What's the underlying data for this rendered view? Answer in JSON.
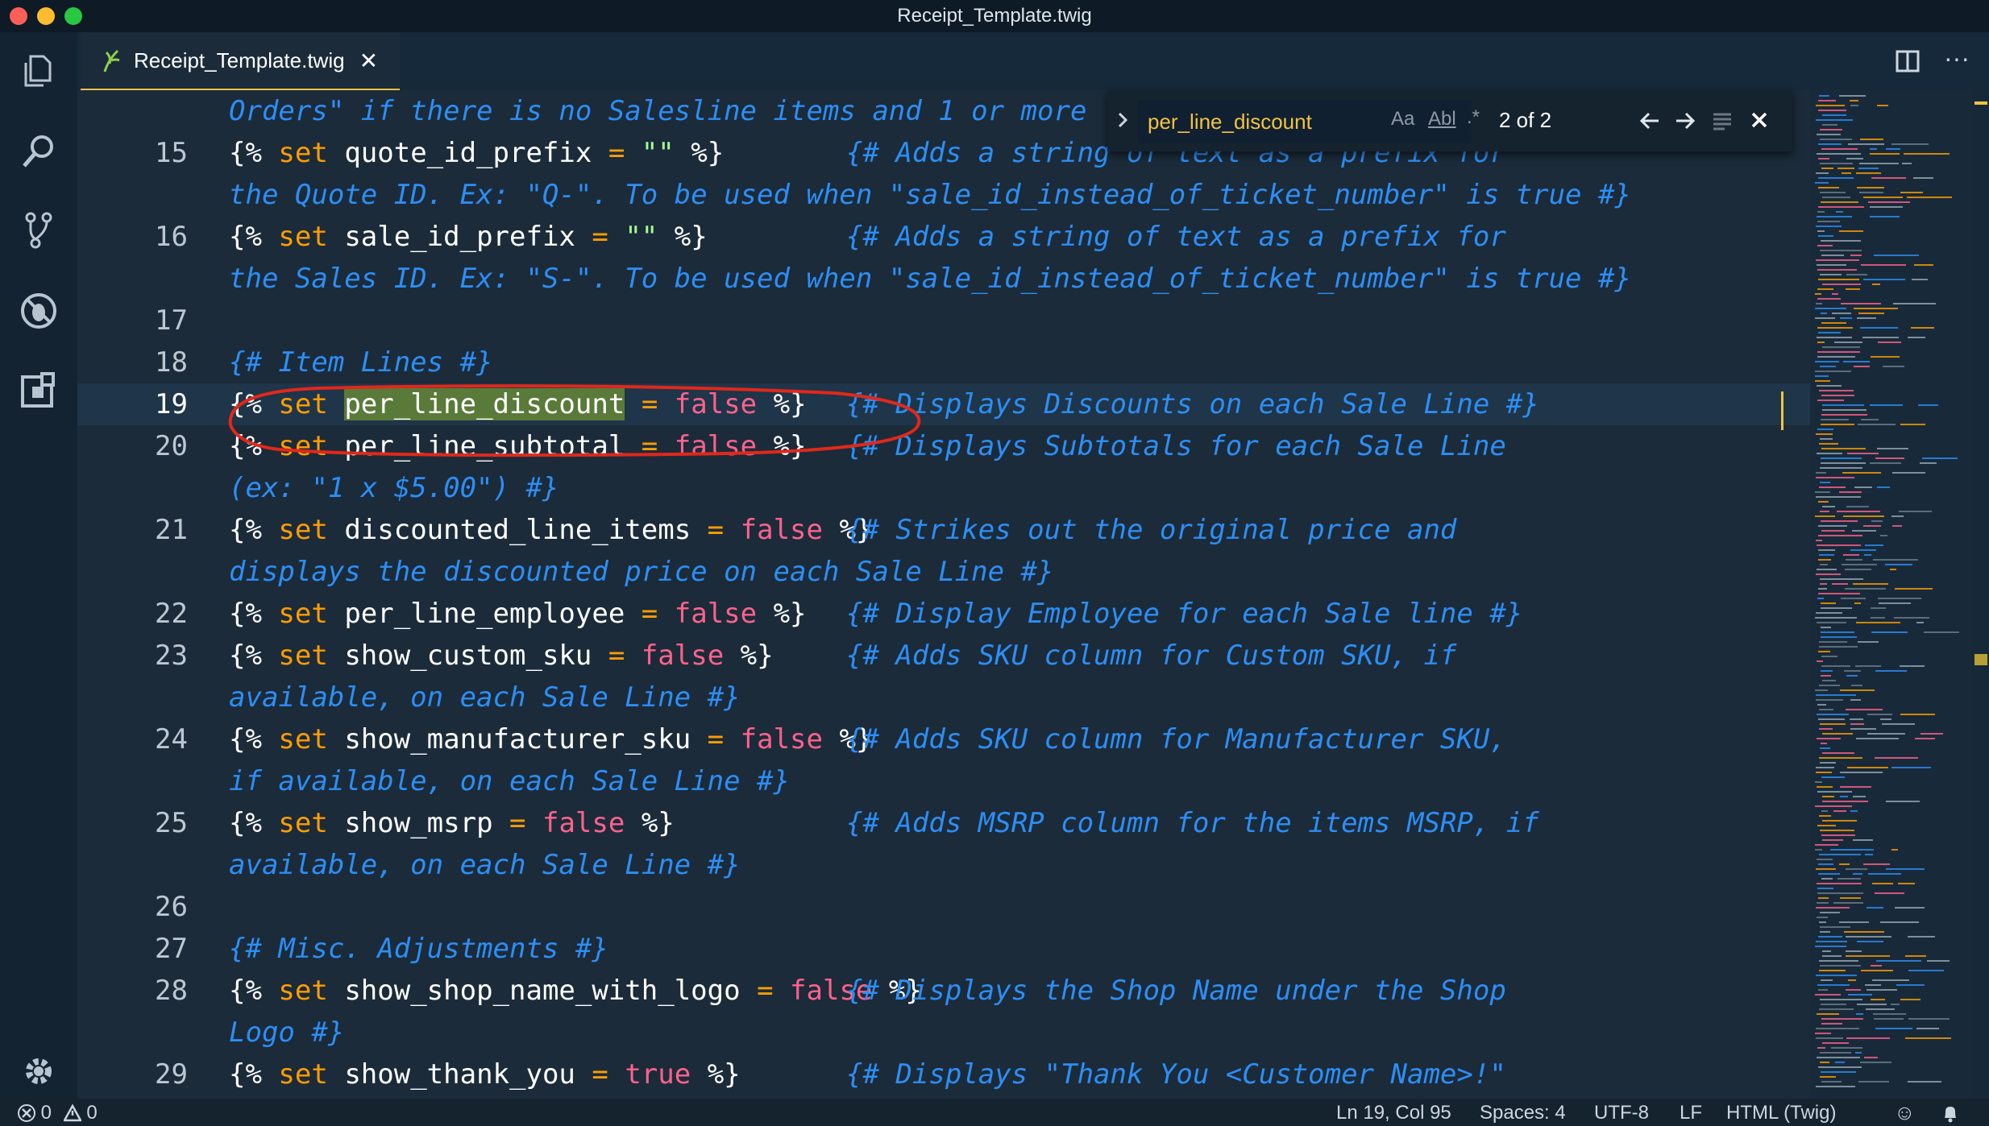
{
  "window": {
    "title": "Receipt_Template.twig"
  },
  "tab": {
    "label": "Receipt_Template.twig"
  },
  "find": {
    "value": "per_line_discount",
    "case_label": "Aa",
    "word_label": "Abl",
    "regex_label": ".*",
    "result_count": "2 of 2"
  },
  "editor": {
    "top_fragment": "Orders\" if there is no Salesline items and 1 or more",
    "lines": [
      {
        "ln": "15",
        "code_html": "{% <span class='kw'>set</span> quote_id_prefix <span class='op'>=</span> <span class='str'>\"\"</span> %}",
        "comment": "{# Adds a string of text as a prefix for",
        "wrap": "the Quote ID. Ex: \"Q-\". To be used when \"sale_id_instead_of_ticket_number\" is true #}"
      },
      {
        "ln": "16",
        "code_html": "{% <span class='kw'>set</span> sale_id_prefix <span class='op'>=</span> <span class='str'>\"\"</span> %}",
        "comment": "{# Adds a string of text as a prefix for",
        "wrap": "the Sales ID. Ex: \"S-\". To be used when \"sale_id_instead_of_ticket_number\" is true #}"
      },
      {
        "ln": "17",
        "code_html": "",
        "comment": "",
        "wrap": ""
      },
      {
        "ln": "18",
        "code_html": "<span style='color:#2d8ef5;font-style:italic'>{# Item Lines #}</span>",
        "comment": "",
        "wrap": ""
      },
      {
        "ln": "19",
        "code_html": "{% <span class='kw'>set</span> <span class='hl'>per_line_discount</span> <span class='op'>=</span> <span class='bool'>false</span> %}",
        "comment": "{# Displays Discounts on each Sale Line #}",
        "wrap": "",
        "current": true
      },
      {
        "ln": "20",
        "code_html": "{% <span class='kw'>set</span> per_line_subtotal <span class='op'>=</span> <span class='bool'>false</span> %}",
        "comment": "{# Displays Subtotals for each Sale Line",
        "wrap": "(ex: \"1 x $5.00\") #}"
      },
      {
        "ln": "21",
        "code_html": "{% <span class='kw'>set</span> discounted_line_items <span class='op'>=</span> <span class='bool'>false</span> %}",
        "comment": "{# Strikes out the original price and",
        "wrap": "displays the discounted price on each Sale Line #}"
      },
      {
        "ln": "22",
        "code_html": "{% <span class='kw'>set</span> per_line_employee <span class='op'>=</span> <span class='bool'>false</span> %}",
        "comment": "{# Display Employee for each Sale line #}",
        "wrap": ""
      },
      {
        "ln": "23",
        "code_html": "{% <span class='kw'>set</span> show_custom_sku <span class='op'>=</span> <span class='bool'>false</span> %}",
        "comment": "{# Adds SKU column for Custom SKU, if",
        "wrap": "available, on each Sale Line #}"
      },
      {
        "ln": "24",
        "code_html": "{% <span class='kw'>set</span> show_manufacturer_sku <span class='op'>=</span> <span class='bool'>false</span> %}",
        "comment": "{# Adds SKU column for Manufacturer SKU,",
        "wrap": "if available, on each Sale Line #}"
      },
      {
        "ln": "25",
        "code_html": "{% <span class='kw'>set</span> show_msrp <span class='op'>=</span> <span class='bool'>false</span> %}",
        "comment": "{# Adds MSRP column for the items MSRP, if",
        "wrap": "available, on each Sale Line #}"
      },
      {
        "ln": "26",
        "code_html": "",
        "comment": "",
        "wrap": ""
      },
      {
        "ln": "27",
        "code_html": "<span style='color:#2d8ef5;font-style:italic'>{# Misc. Adjustments #}</span>",
        "comment": "",
        "wrap": ""
      },
      {
        "ln": "28",
        "code_html": "{% <span class='kw'>set</span> show_shop_name_with_logo <span class='op'>=</span> <span class='bool'>false</span> %}",
        "comment": "{# Displays the Shop Name under the Shop",
        "wrap": "Logo #}"
      },
      {
        "ln": "29",
        "code_html": "{% <span class='kw'>set</span> show_thank_you <span class='op'>=</span> <span class='bool'>true</span> %}",
        "comment": "{# Displays \"Thank You <Customer Name>!\"",
        "wrap": ""
      }
    ]
  },
  "status": {
    "errors": "0",
    "warnings": "0",
    "position": "Ln 19, Col 95",
    "spaces": "Spaces: 4",
    "encoding": "UTF-8",
    "eol": "LF",
    "language": "HTML (Twig)"
  },
  "icons": {
    "activity": [
      "files-icon",
      "search-icon",
      "source-control-icon",
      "debug-icon",
      "extensions-icon",
      "gear-icon"
    ],
    "tab": [
      "twig-file-icon",
      "close-icon"
    ],
    "editor_actions": [
      "split-editor-icon",
      "more-icon"
    ],
    "find": [
      "toggle-replace-icon",
      "match-case-icon",
      "whole-word-icon",
      "regex-icon",
      "previous-match-icon",
      "next-match-icon",
      "find-in-selection-icon",
      "close-find-icon"
    ],
    "status": [
      "error-icon",
      "warning-icon",
      "smiley-icon",
      "bell-icon"
    ]
  },
  "colors": {
    "keyword": "#ff9d00",
    "boolean": "#ff628c",
    "string": "#a5ff90",
    "comment": "#2d8ef5",
    "highlight": "#5a7a39",
    "annotation_circle": "#e0281b"
  }
}
